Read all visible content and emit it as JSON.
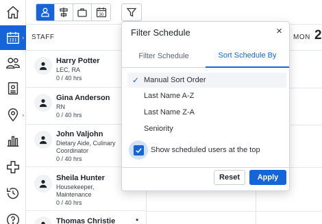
{
  "nav": {
    "items": [
      {
        "icon": "home-icon"
      },
      {
        "icon": "calendar-icon",
        "active": true
      },
      {
        "icon": "people-icon"
      },
      {
        "icon": "badge-icon"
      },
      {
        "icon": "location-pin-icon"
      },
      {
        "icon": "bar-chart-icon"
      },
      {
        "icon": "plus-cross-icon"
      },
      {
        "icon": "history-icon"
      },
      {
        "icon": "help-icon"
      }
    ]
  },
  "toolbar": {
    "views": [
      {
        "icon": "person-icon",
        "active": true
      },
      {
        "icon": "list-align-icon"
      },
      {
        "icon": "briefcase-icon"
      },
      {
        "icon": "calendar-30-icon",
        "text": "30"
      }
    ],
    "filter_icon": "funnel-icon"
  },
  "schedule": {
    "staff_header": "STAFF",
    "day_label": "MON",
    "day_num": "2"
  },
  "staff": [
    {
      "name": "Harry Potter",
      "role_lines": [
        "LEC, RA"
      ],
      "hours": "0 / 40 hrs"
    },
    {
      "name": "Gina Anderson",
      "role_lines": [
        "RN"
      ],
      "hours": "0 / 40 hrs"
    },
    {
      "name": "John Valjohn",
      "role_lines": [
        "Dietary Aide, Culinary",
        "Coordinator"
      ],
      "hours": "0 / 40 hrs"
    },
    {
      "name": "Sheila Hunter",
      "role_lines": [
        "Housekeeper,",
        "Maintenance"
      ],
      "hours": "0 / 40 hrs"
    },
    {
      "name": "Thomas Christie",
      "role_lines": [],
      "hours": ""
    }
  ],
  "popup": {
    "title": "Filter Schedule",
    "close": "×",
    "tabs": [
      "Filter Schedule",
      "Sort Schedule By"
    ],
    "active_tab": 1,
    "options": [
      {
        "label": "Manual Sort Order",
        "selected": true
      },
      {
        "label": "Last Name A-Z",
        "selected": false
      },
      {
        "label": "Last Name Z-A",
        "selected": false
      },
      {
        "label": "Seniority",
        "selected": false
      }
    ],
    "checkbox_label": "Show scheduled users at the top",
    "checkbox_checked": true,
    "reset_label": "Reset",
    "apply_label": "Apply"
  },
  "colors": {
    "accent": "#1565d8"
  }
}
